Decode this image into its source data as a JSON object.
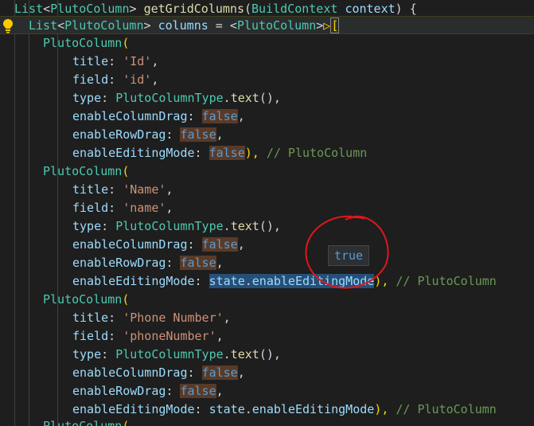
{
  "lines": [
    [
      "List",
      "<",
      "PlutoColumn",
      "> ",
      "getGridColumns",
      "(",
      "BuildContext",
      " ",
      "context",
      ") ",
      "{"
    ],
    [
      "List",
      "<",
      "PlutoColumn",
      "> ",
      "columns",
      " = <",
      "PlutoColumn",
      ">",
      "▷",
      "["
    ],
    [
      "PlutoColumn",
      "("
    ],
    [
      "title",
      ": ",
      "'Id'",
      ","
    ],
    [
      "field",
      ": ",
      "'id'",
      ","
    ],
    [
      "type",
      ": ",
      "PlutoColumnType",
      ".",
      "text",
      "(),"
    ],
    [
      "enableColumnDrag",
      ": ",
      "false",
      ","
    ],
    [
      "enableRowDrag",
      ": ",
      "false",
      ","
    ],
    [
      "enableEditingMode",
      ": ",
      "false",
      "), ",
      "// PlutoColumn"
    ],
    [
      "PlutoColumn",
      "("
    ],
    [
      "title",
      ": ",
      "'Name'",
      ","
    ],
    [
      "field",
      ": ",
      "'name'",
      ","
    ],
    [
      "type",
      ": ",
      "PlutoColumnType",
      ".",
      "text",
      "(),"
    ],
    [
      "enableColumnDrag",
      ": ",
      "false",
      ","
    ],
    [
      "enableRowDrag",
      ": ",
      "false",
      ","
    ],
    [
      "enableEditingMode",
      ": ",
      "state",
      ".",
      "enableEditingMode",
      "), ",
      "// PlutoColumn"
    ],
    [
      "PlutoColumn",
      "("
    ],
    [
      "title",
      ": ",
      "'Phone Number'",
      ","
    ],
    [
      "field",
      ": ",
      "'phoneNumber'",
      ","
    ],
    [
      "type",
      ": ",
      "PlutoColumnType",
      ".",
      "text",
      "(),"
    ],
    [
      "enableColumnDrag",
      ": ",
      "false",
      ","
    ],
    [
      "enableRowDrag",
      ": ",
      "false",
      ","
    ],
    [
      "enableEditingMode",
      ": ",
      "state",
      ".",
      "enableEditingMode",
      "), ",
      "// PlutoColumn"
    ],
    [
      "PlutoColumn",
      "("
    ]
  ],
  "hover": {
    "value": "true"
  },
  "icons": {
    "lightbulb": "lightbulb-icon",
    "annotation": "red-circle-annotation"
  }
}
